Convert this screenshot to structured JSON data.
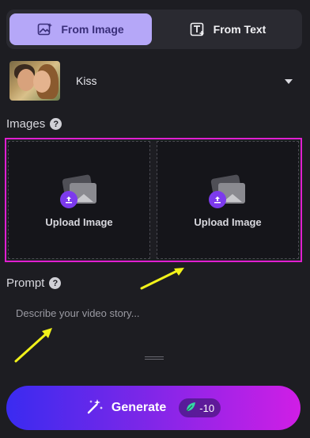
{
  "tabs": [
    {
      "label": "From Image",
      "icon": "image-icon",
      "active": true
    },
    {
      "label": "From Text",
      "icon": "text-icon",
      "active": false
    }
  ],
  "style_select": {
    "value": "Kiss",
    "thumbnail": "kiss-couple-thumbnail"
  },
  "images_section": {
    "label": "Images",
    "help_glyph": "?"
  },
  "upload_boxes": [
    {
      "label": "Upload Image"
    },
    {
      "label": "Upload Image"
    }
  ],
  "prompt_section": {
    "label": "Prompt",
    "help_glyph": "?",
    "placeholder": "Describe your video story..."
  },
  "generate_button": {
    "label": "Generate",
    "credit": "-10"
  },
  "colors": {
    "background": "#1d1d22",
    "tab_active": "#b5a7f8",
    "upload_highlight": "#e01fd0",
    "annotation_arrow": "#f2f21a",
    "generate_gradient_start": "#3a2bf0",
    "generate_gradient_end": "#d01ee6"
  }
}
